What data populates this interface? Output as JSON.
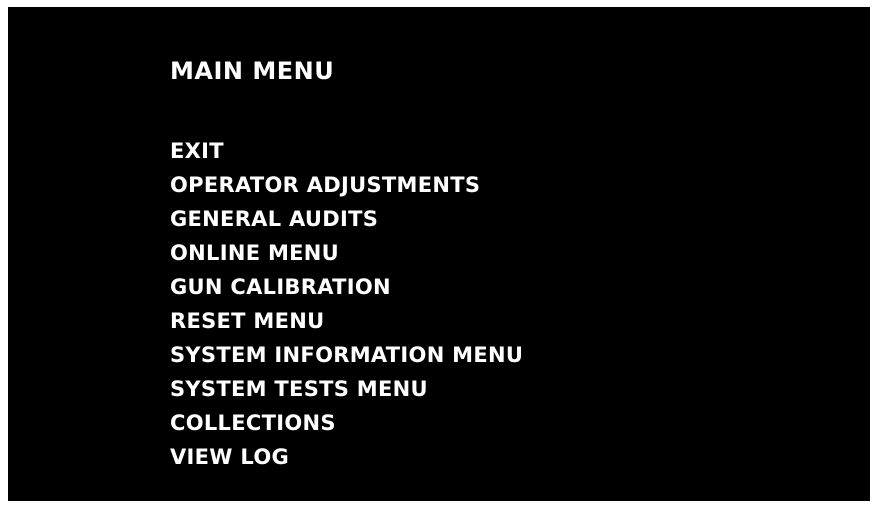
{
  "title": "MAIN MENU",
  "menu_items": [
    "EXIT",
    "OPERATOR ADJUSTMENTS",
    "GENERAL AUDITS",
    "ONLINE MENU",
    "GUN CALIBRATION",
    "RESET MENU",
    "SYSTEM INFORMATION MENU",
    "SYSTEM TESTS MENU",
    "COLLECTIONS",
    "VIEW LOG"
  ],
  "colors": {
    "background": "#000000",
    "text": "#ffffff",
    "border": "#ffffff"
  }
}
